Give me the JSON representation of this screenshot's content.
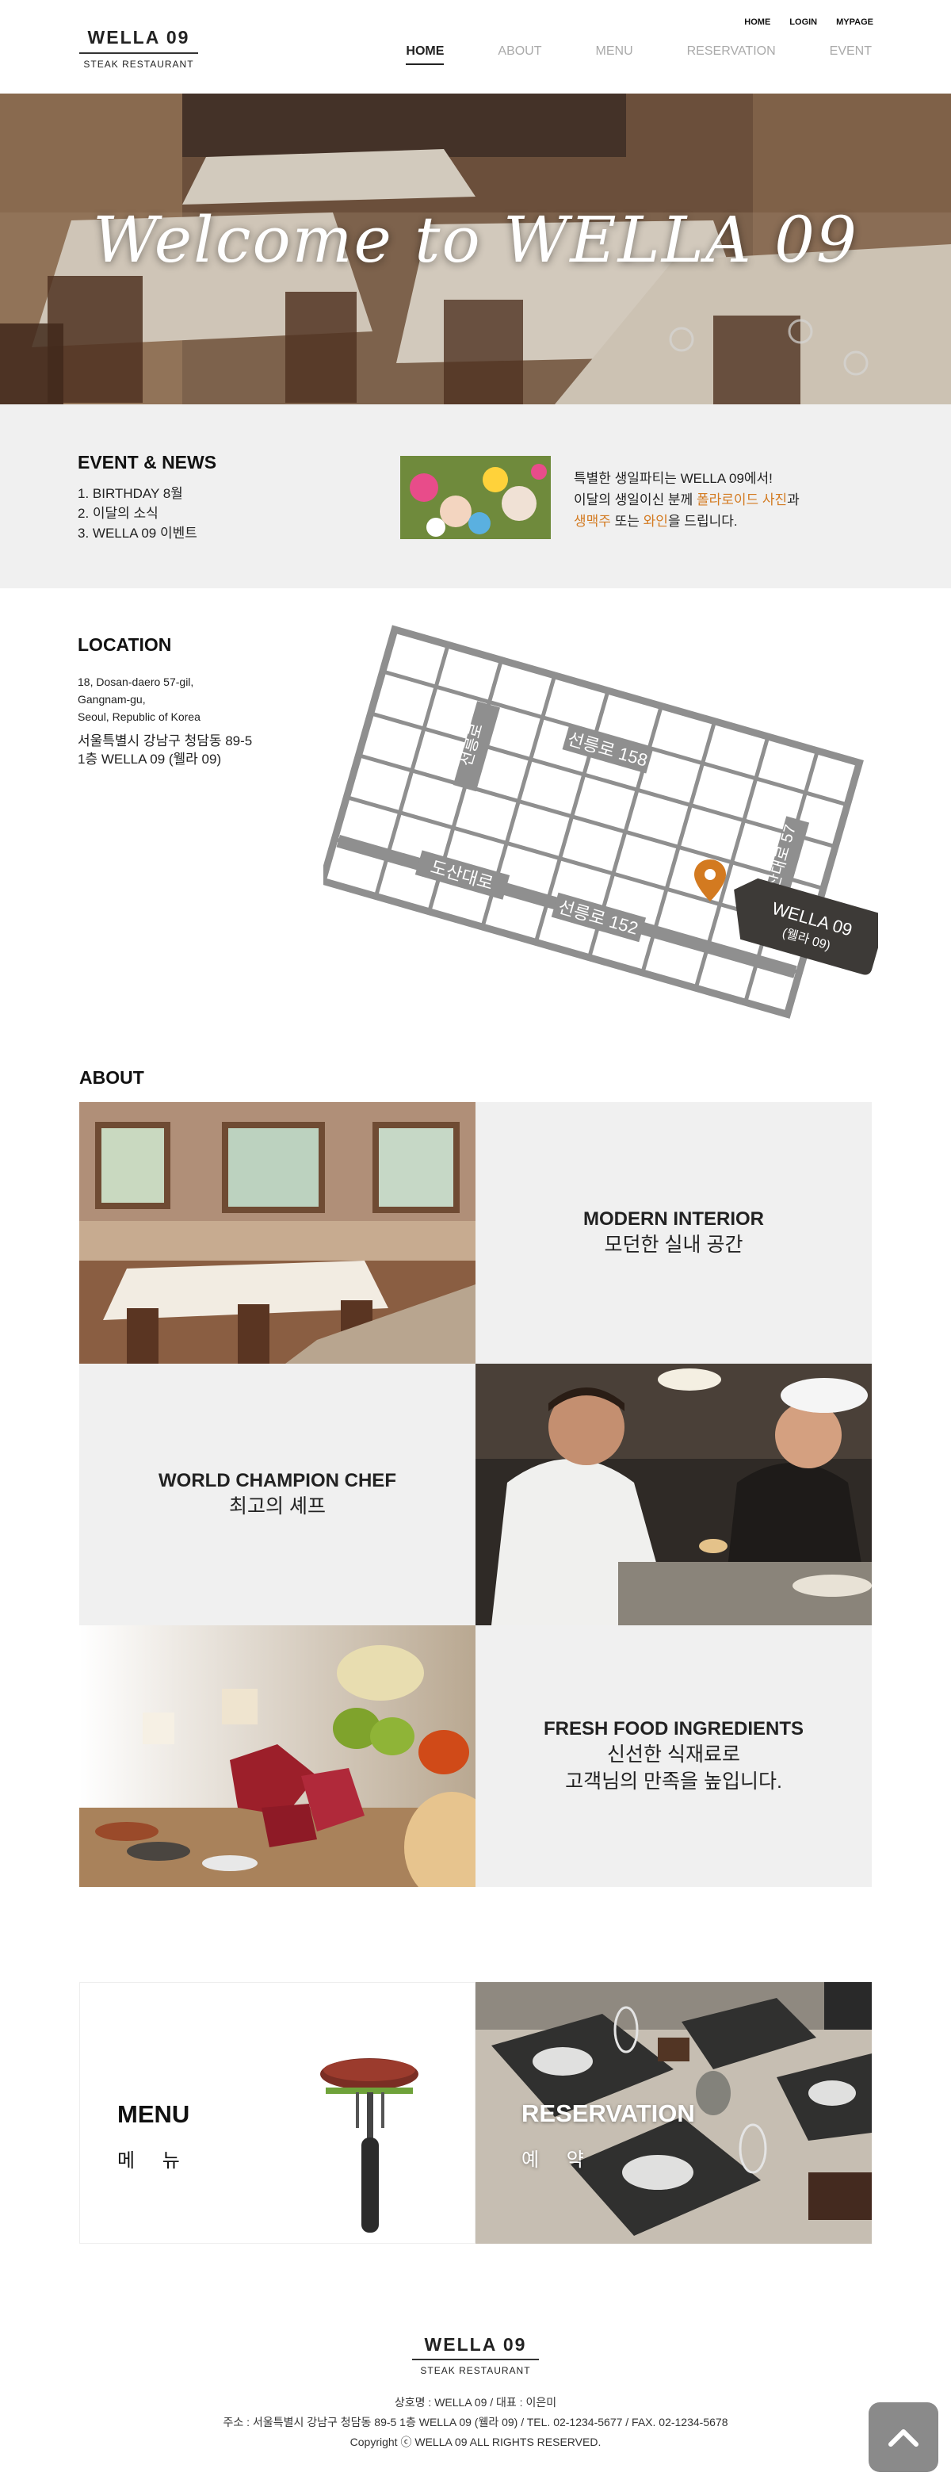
{
  "header": {
    "logo_name": "WELLA 09",
    "logo_sub": "STEAK RESTAURANT",
    "util": [
      "HOME",
      "LOGIN",
      "MYPAGE"
    ],
    "nav": [
      "HOME",
      "ABOUT",
      "MENU",
      "RESERVATION",
      "EVENT"
    ],
    "active_nav": "HOME"
  },
  "hero": {
    "title": "Welcome to WELLA 09"
  },
  "event": {
    "title": "EVENT & NEWS",
    "items": [
      "1. BIRTHDAY 8월",
      "2. 이달의 소식",
      "3. WELLA 09 이벤트"
    ],
    "line1": "특별한 생일파티는 WELLA 09에서!",
    "line2_a": "이달의 생일이신 분께 ",
    "line2_hl": "폴라로이드 사진",
    "line2_b": "과",
    "line3_hl1": "생맥주",
    "line3_a": " 또는 ",
    "line3_hl2": "와인",
    "line3_b": "을 드립니다."
  },
  "location": {
    "title": "LOCATION",
    "address_en": [
      "18, Dosan-daero 57-gil,",
      "Gangnam-gu,",
      "Seoul, Republic of Korea"
    ],
    "address_ko": [
      "서울특별시 강남구 청담동 89-5",
      "1층 WELLA 09 (웰라 09)"
    ],
    "map_labels": {
      "road1": "선릉로 158",
      "road2": "선릉로",
      "road3": "도산대로 57",
      "road4": "도산대로",
      "road5": "선릉로 152",
      "pin_name": "WELLA 09",
      "pin_sub": "(웰라 09)"
    }
  },
  "about": {
    "title": "ABOUT",
    "tiles": [
      {
        "en": "MODERN INTERIOR",
        "ko": "모던한 실내 공간"
      },
      {
        "en": "WORLD CHAMPION CHEF",
        "ko": "최고의 셰프"
      },
      {
        "en": "FRESH FOOD INGREDIENTS",
        "ko": "신선한 식재료로",
        "ko2": "고객님의 만족을 높입니다."
      }
    ]
  },
  "menu": {
    "en": "MENU",
    "ko": "메 뉴"
  },
  "reservation": {
    "en": "RESERVATION",
    "ko": "예 약"
  },
  "footer": {
    "logo_name": "WELLA 09",
    "logo_sub": "STEAK RESTAURANT",
    "line1": "상호명 : WELLA 09   /   대표 : 이은미",
    "line2": "주소 : 서울특별시 강남구 청담동 89-5 1층 WELLA 09 (웰라 09)   /   TEL. 02-1234-5677   /   FAX. 02-1234-5678",
    "line3": "Copyright ⓒ WELLA 09  ALL RIGHTS RESERVED."
  },
  "colors": {
    "accent": "#d37a20",
    "panel": "#f0f0f0",
    "map_road": "#8f8f8f",
    "pin_tag": "#3d3a37"
  },
  "icons": [
    "map-pin-icon",
    "chevron-up-icon"
  ]
}
